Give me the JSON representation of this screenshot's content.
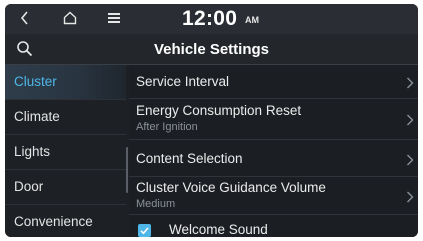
{
  "status_bar": {
    "time": "12:00",
    "ampm": "AM",
    "icons": [
      "back-icon",
      "home-icon",
      "menu-icon"
    ]
  },
  "title_bar": {
    "title": "Vehicle Settings",
    "search_icon": "search-icon"
  },
  "sidebar": {
    "items": [
      {
        "label": "Cluster",
        "active": true
      },
      {
        "label": "Climate",
        "active": false
      },
      {
        "label": "Lights",
        "active": false
      },
      {
        "label": "Door",
        "active": false
      },
      {
        "label": "Convenience",
        "active": false
      }
    ]
  },
  "content": {
    "rows": [
      {
        "title": "Service Interval",
        "subtitle": "",
        "type": "chevron"
      },
      {
        "title": "Energy Consumption Reset",
        "subtitle": "After Ignition",
        "type": "chevron"
      },
      {
        "title": "Content Selection",
        "subtitle": "",
        "type": "chevron"
      },
      {
        "title": "Cluster Voice Guidance Volume",
        "subtitle": "Medium",
        "type": "chevron"
      },
      {
        "title": "Welcome Sound",
        "subtitle": "",
        "type": "checkbox",
        "checked": true
      }
    ]
  },
  "colors": {
    "accent": "#4fb7e8",
    "background": "#1b1e23",
    "text": "#ececec",
    "subtext": "#8c9098"
  }
}
